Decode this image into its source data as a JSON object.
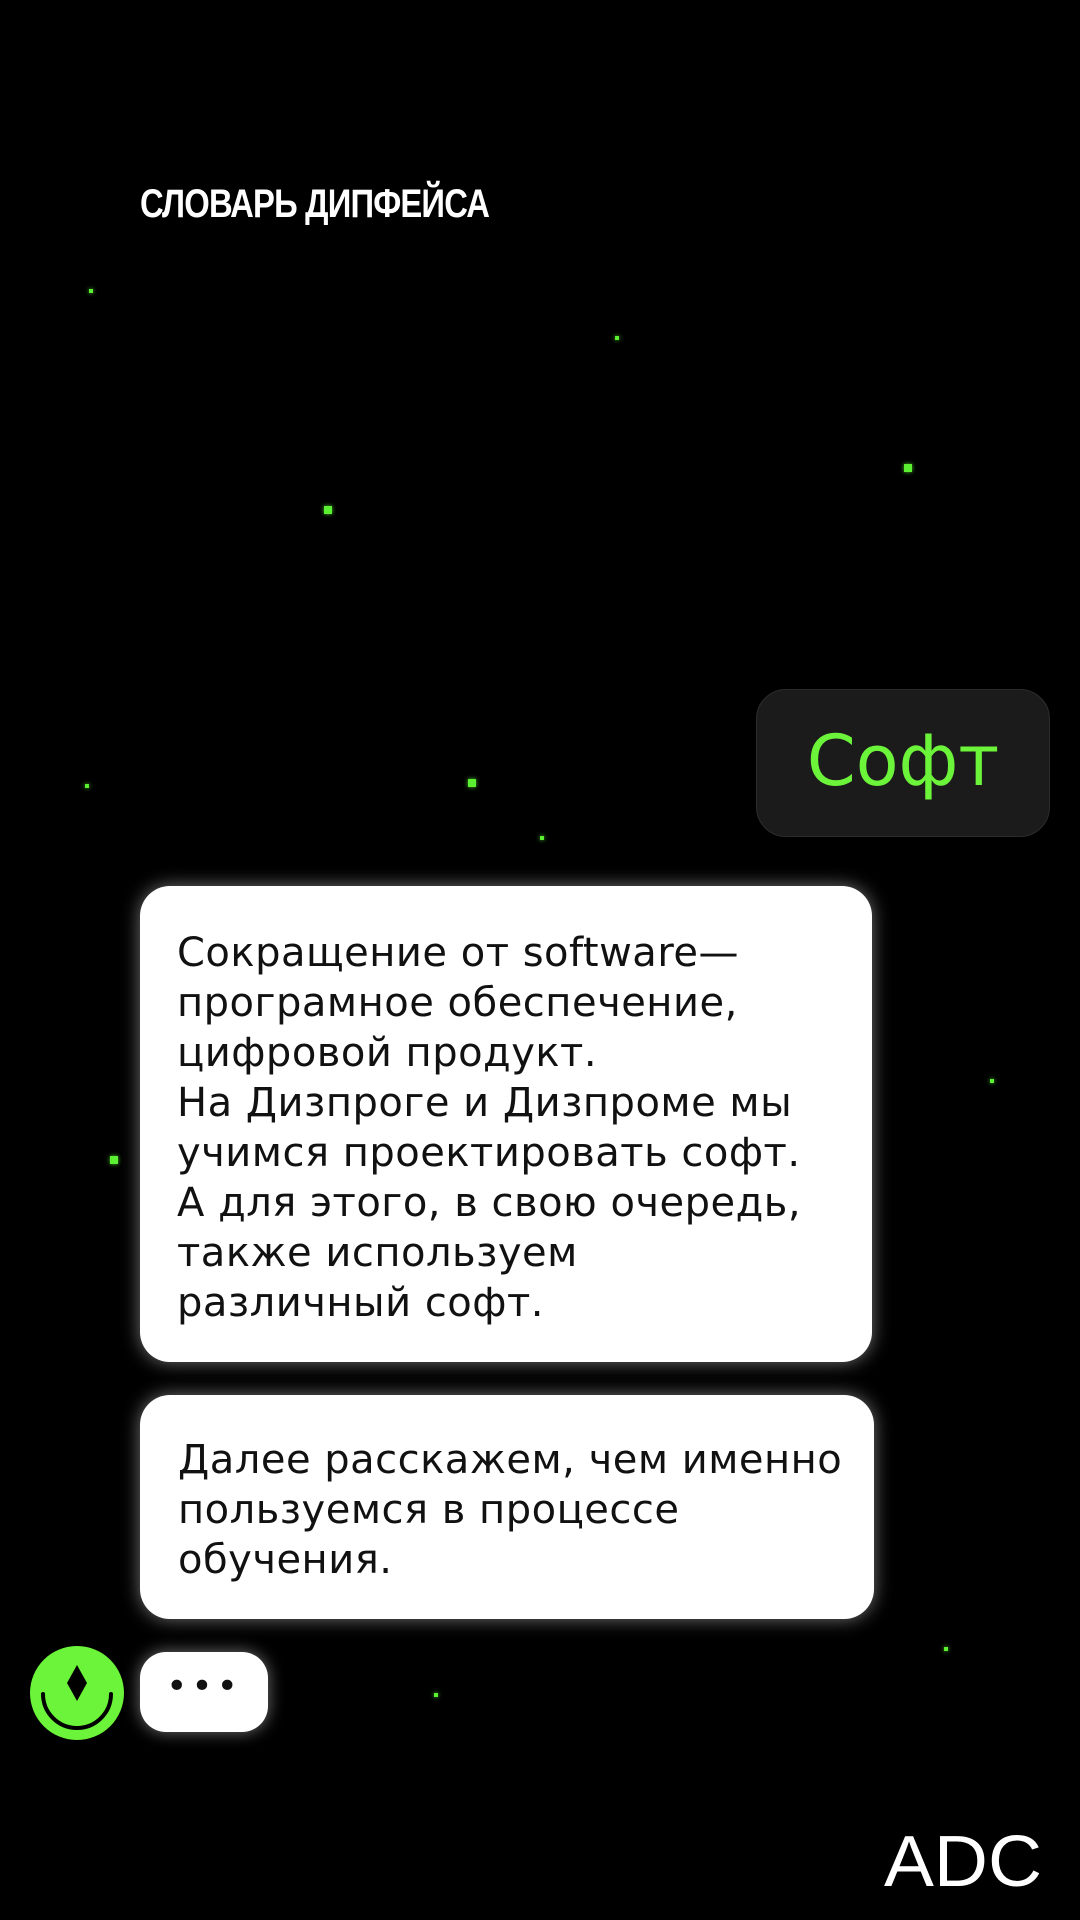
{
  "header": {
    "title": "СЛОВАРЬ ДИПФЕЙСА"
  },
  "term": {
    "label": "Софт"
  },
  "messages": [
    {
      "lines": [
        "Сокращение от software—",
        "програмное обеспечение,",
        "цифровой продукт.",
        "На Дизпроге и Дизпроме мы",
        "учимся проектировать софт.",
        "А для этого, в свою очередь,",
        "также используем",
        "различный софт."
      ]
    },
    {
      "lines": [
        "Далее расскажем, чем именно",
        "пользуемся в процессе",
        "обучения."
      ]
    }
  ],
  "typing": {
    "indicator": "•••"
  },
  "avatar": {
    "icon": "smiley-diamond-icon"
  },
  "brand": {
    "logo_text": "ADC"
  },
  "colors": {
    "background": "#000000",
    "accent_green": "#6cf43a",
    "bubble_white": "#ffffff",
    "term_bubble": "#1b1b1b"
  }
}
